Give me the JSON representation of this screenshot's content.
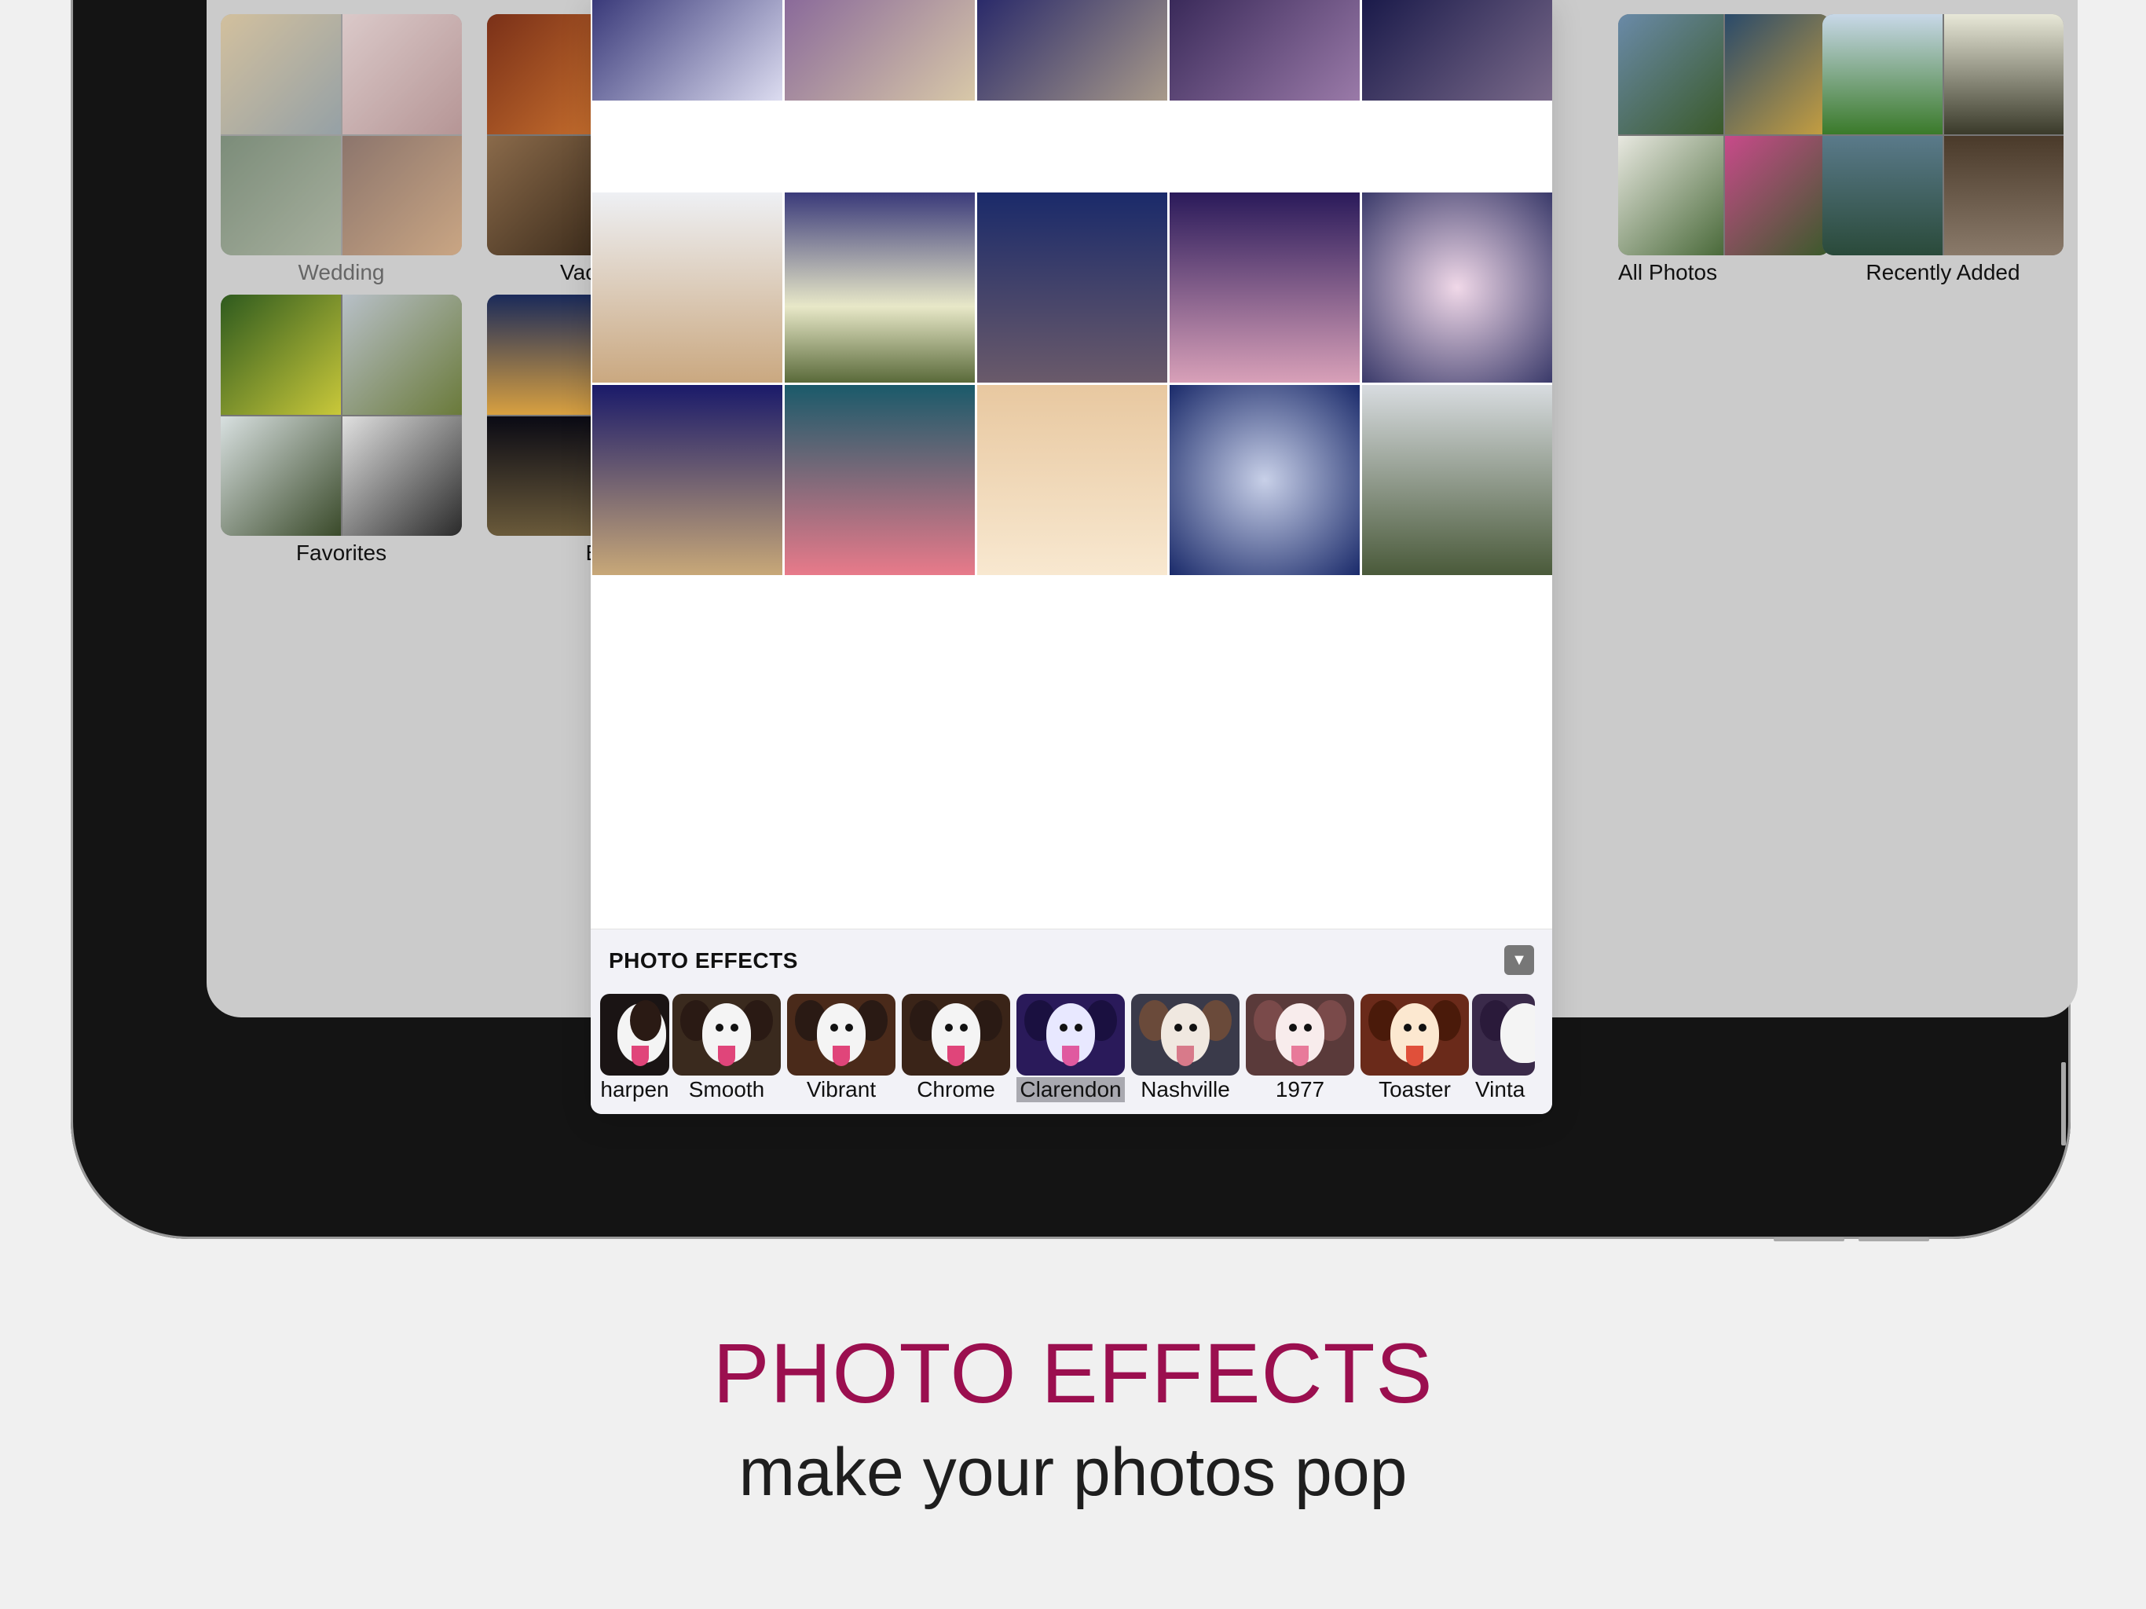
{
  "albums": [
    {
      "label": "Wedding"
    },
    {
      "label": "Vacations"
    },
    {
      "label": "Favorites"
    },
    {
      "label": "Best"
    },
    {
      "label": "All Photos"
    },
    {
      "label": "Recently Added"
    }
  ],
  "popover": {
    "effects_panel": {
      "title": "PHOTO EFFECTS",
      "collapse_icon": "▼",
      "effects": [
        {
          "label": "harpen"
        },
        {
          "label": "Smooth"
        },
        {
          "label": "Vibrant"
        },
        {
          "label": "Chrome"
        },
        {
          "label": "Clarendon",
          "selected": true
        },
        {
          "label": "Nashville"
        },
        {
          "label": "1977"
        },
        {
          "label": "Toaster"
        },
        {
          "label": "Vinta"
        }
      ]
    }
  },
  "marketing": {
    "headline": "PHOTO EFFECTS",
    "subline": "make your photos pop"
  },
  "colors": {
    "headline": "#9b0f4f",
    "screen_bg": "#cbcbcb",
    "device_frame": "#141414"
  }
}
